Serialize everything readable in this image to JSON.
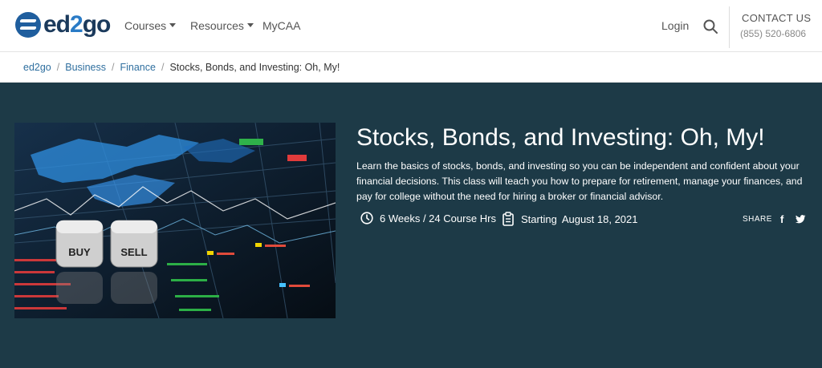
{
  "header": {
    "logo_text": "ed2go",
    "logo_prefix": "ed",
    "logo_mid": "2",
    "logo_suffix": "go",
    "nav": {
      "courses": "Courses",
      "resources": "Resources",
      "mycaa": "MyCAA"
    },
    "login": "Login",
    "contact_label": "CONTACT US",
    "phone": "(855) 520-6806"
  },
  "breadcrumb": {
    "items": [
      "ed2go",
      "Business",
      "Finance"
    ],
    "current": "Stocks, Bonds, and Investing: Oh, My!"
  },
  "hero": {
    "title": "Stocks, Bonds, and Investing: Oh, My!",
    "description": "Learn the basics of stocks, bonds, and investing so you can be independent and confident about your financial decisions. This class will teach you how to prepare for retirement, manage your finances, and pay for college without the need for hiring a broker or financial advisor.",
    "duration": "6 Weeks / 24 Course Hrs",
    "starting_label": "Starting",
    "start_date": "August 18, 2021",
    "share_label": "SHARE",
    "image_dice": [
      "BUY",
      "SELL"
    ]
  },
  "colors": {
    "hero_bg": "#1d3a47",
    "link": "#2f6f9f",
    "logo_blue": "#1f5e9e"
  }
}
